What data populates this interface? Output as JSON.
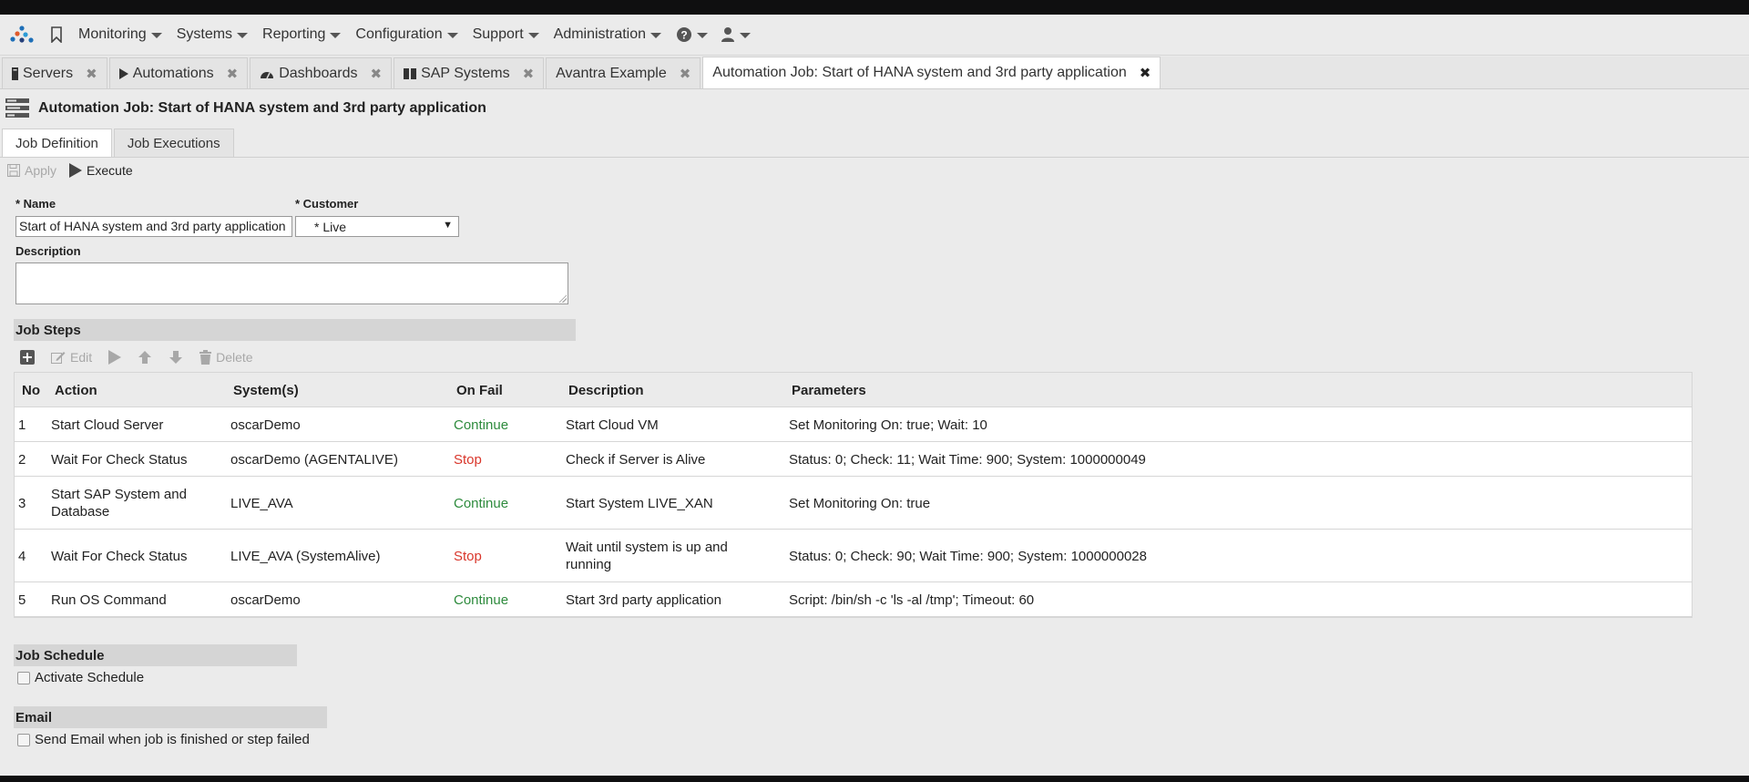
{
  "nav": {
    "items": [
      {
        "label": "Monitoring"
      },
      {
        "label": "Systems"
      },
      {
        "label": "Reporting"
      },
      {
        "label": "Configuration"
      },
      {
        "label": "Support"
      },
      {
        "label": "Administration"
      }
    ]
  },
  "tabs": [
    {
      "label": "Servers"
    },
    {
      "label": "Automations"
    },
    {
      "label": "Dashboards"
    },
    {
      "label": "SAP Systems"
    },
    {
      "label": "Avantra Example"
    },
    {
      "label": "Automation Job: Start of HANA system and 3rd party application"
    }
  ],
  "page": {
    "title": "Automation Job: Start of HANA system and 3rd party application"
  },
  "subtabs": [
    {
      "label": "Job Definition"
    },
    {
      "label": "Job Executions"
    }
  ],
  "toolbar": {
    "apply": "Apply",
    "execute": "Execute"
  },
  "form": {
    "name_label": "* Name",
    "name_value": "Start of HANA system and 3rd party application",
    "customer_label": "* Customer",
    "customer_value": "* Live",
    "description_label": "Description",
    "description_value": ""
  },
  "job_steps": {
    "header": "Job Steps",
    "toolbar": {
      "edit": "Edit",
      "delete": "Delete"
    },
    "columns": [
      "No",
      "Action",
      "System(s)",
      "On Fail",
      "Description",
      "Parameters"
    ],
    "rows": [
      {
        "no": "1",
        "action": "Start Cloud Server",
        "systems": "oscarDemo",
        "on_fail": "Continue",
        "description": "Start Cloud VM",
        "parameters": "Set Monitoring On: true; Wait: 10"
      },
      {
        "no": "2",
        "action": "Wait For Check Status",
        "systems": "oscarDemo (AGENTALIVE)",
        "on_fail": "Stop",
        "description": "Check if Server is Alive",
        "parameters": "Status: 0; Check: 11; Wait Time: 900; System: 1000000049"
      },
      {
        "no": "3",
        "action": "Start SAP System and Database",
        "systems": "LIVE_AVA",
        "on_fail": "Continue",
        "description": "Start System LIVE_XAN",
        "parameters": "Set Monitoring On: true"
      },
      {
        "no": "4",
        "action": "Wait For Check Status",
        "systems": "LIVE_AVA (SystemAlive)",
        "on_fail": "Stop",
        "description": "Wait until system is up and running",
        "parameters": "Status: 0; Check: 90; Wait Time: 900; System: 1000000028"
      },
      {
        "no": "5",
        "action": "Run OS Command",
        "systems": "oscarDemo",
        "on_fail": "Continue",
        "description": "Start 3rd party application",
        "parameters": "Script: /bin/sh -c 'ls -al /tmp'; Timeout: 60"
      }
    ]
  },
  "schedule": {
    "header": "Job Schedule",
    "activate_label": "Activate Schedule"
  },
  "email": {
    "header": "Email",
    "send_label": "Send Email when job is finished or step failed"
  },
  "colors": {
    "continue": "#2e8b3d",
    "stop": "#d9362b"
  }
}
